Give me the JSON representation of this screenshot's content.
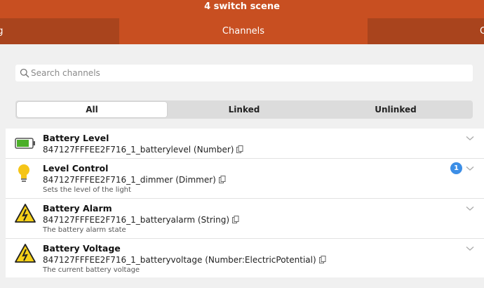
{
  "window": {
    "title": "4 switch scene"
  },
  "tabs": [
    {
      "label": "ng",
      "active": false
    },
    {
      "label": "Channels",
      "active": true
    },
    {
      "label": "C",
      "active": false
    }
  ],
  "search": {
    "placeholder": "Search channels",
    "value": "",
    "icon": "search-icon"
  },
  "filter": {
    "options": [
      "All",
      "Linked",
      "Unlinked"
    ],
    "selected": "All"
  },
  "channels": [
    {
      "title": "Battery Level",
      "id": "847127FFFEE2F716_1_batterylevel (Number)",
      "description": "",
      "icon": "battery-icon",
      "badge": ""
    },
    {
      "title": "Level Control",
      "id": "847127FFFEE2F716_1_dimmer (Dimmer)",
      "description": "Sets the level of the light",
      "icon": "lightbulb-icon",
      "badge": "1"
    },
    {
      "title": "Battery Alarm",
      "id": "847127FFFEE2F716_1_batteryalarm (String)",
      "description": "The battery alarm state",
      "icon": "warning-icon",
      "badge": ""
    },
    {
      "title": "Battery Voltage",
      "id": "847127FFFEE2F716_1_batteryvoltage (Number:ElectricPotential)",
      "description": "The current battery voltage",
      "icon": "warning-icon",
      "badge": ""
    }
  ],
  "colors": {
    "header": "#c84f21",
    "inactive_tab": "#a9441d",
    "badge": "#3c8ee6",
    "battery_fill": "#4caf2a",
    "bulb": "#f5c518",
    "warning": "#f7d117"
  }
}
